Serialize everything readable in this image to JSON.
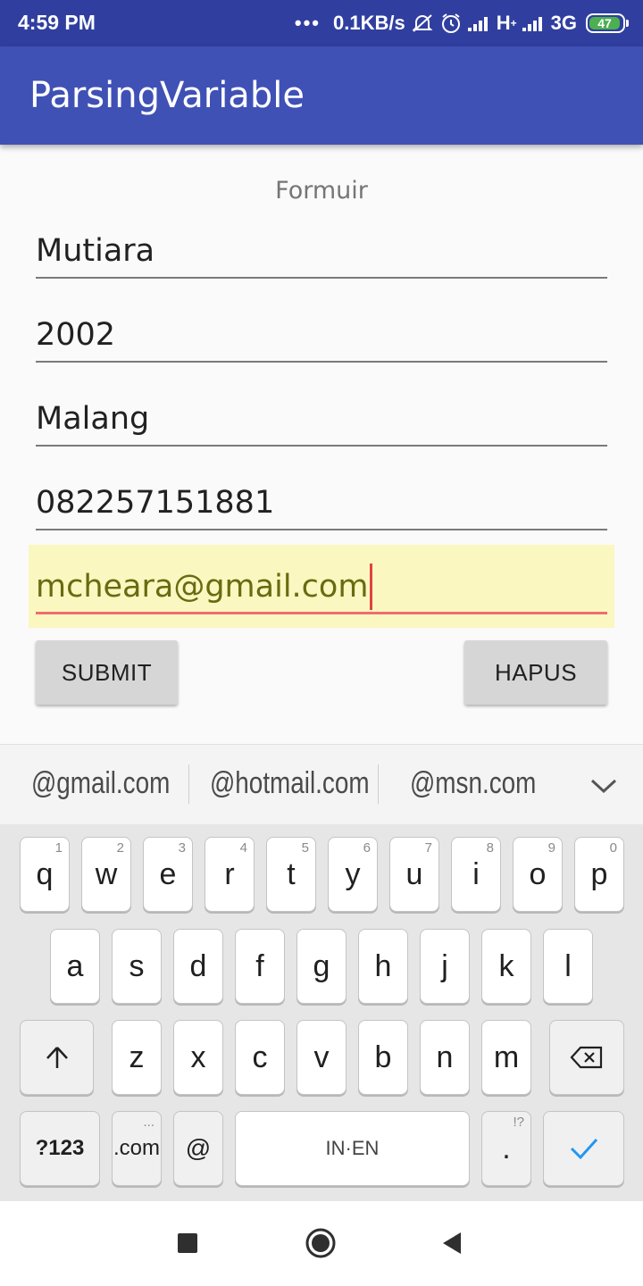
{
  "status_bar": {
    "time": "4:59 PM",
    "dots": "•••",
    "network_speed": "0.1KB/s",
    "signal1_label": "H",
    "signal1_sub": "+",
    "network_type": "3G",
    "battery": "47"
  },
  "app_bar": {
    "title": "ParsingVariable"
  },
  "form": {
    "title": "Formuir",
    "fields": [
      {
        "value": "Mutiara"
      },
      {
        "value": "2002"
      },
      {
        "value": "Malang"
      },
      {
        "value": "082257151881"
      },
      {
        "value": "mcheara@gmail.com",
        "focused": true
      }
    ],
    "submit_label": "SUBMIT",
    "hapus_label": "HAPUS"
  },
  "suggestions": [
    "@gmail.com",
    "@hotmail.com",
    "@msn.com"
  ],
  "keyboard": {
    "row1": [
      {
        "k": "q",
        "h": "1"
      },
      {
        "k": "w",
        "h": "2"
      },
      {
        "k": "e",
        "h": "3"
      },
      {
        "k": "r",
        "h": "4"
      },
      {
        "k": "t",
        "h": "5"
      },
      {
        "k": "y",
        "h": "6"
      },
      {
        "k": "u",
        "h": "7"
      },
      {
        "k": "i",
        "h": "8"
      },
      {
        "k": "o",
        "h": "9"
      },
      {
        "k": "p",
        "h": "0"
      }
    ],
    "row2": [
      "a",
      "s",
      "d",
      "f",
      "g",
      "h",
      "j",
      "k",
      "l"
    ],
    "row3": [
      "z",
      "x",
      "c",
      "v",
      "b",
      "n",
      "m"
    ],
    "symbols_label": "?123",
    "dotcom_label": ".com",
    "dotcom_hint": "...",
    "at_label": "@",
    "space_label": "IN·EN",
    "period_label": ".",
    "period_hint": "!?"
  },
  "colors": {
    "status_bar": "#303f9f",
    "app_bar": "#3f51b5",
    "focus_underline": "#ef6e6e",
    "focus_bg": "#fbf7c0",
    "check": "#2196f3"
  }
}
